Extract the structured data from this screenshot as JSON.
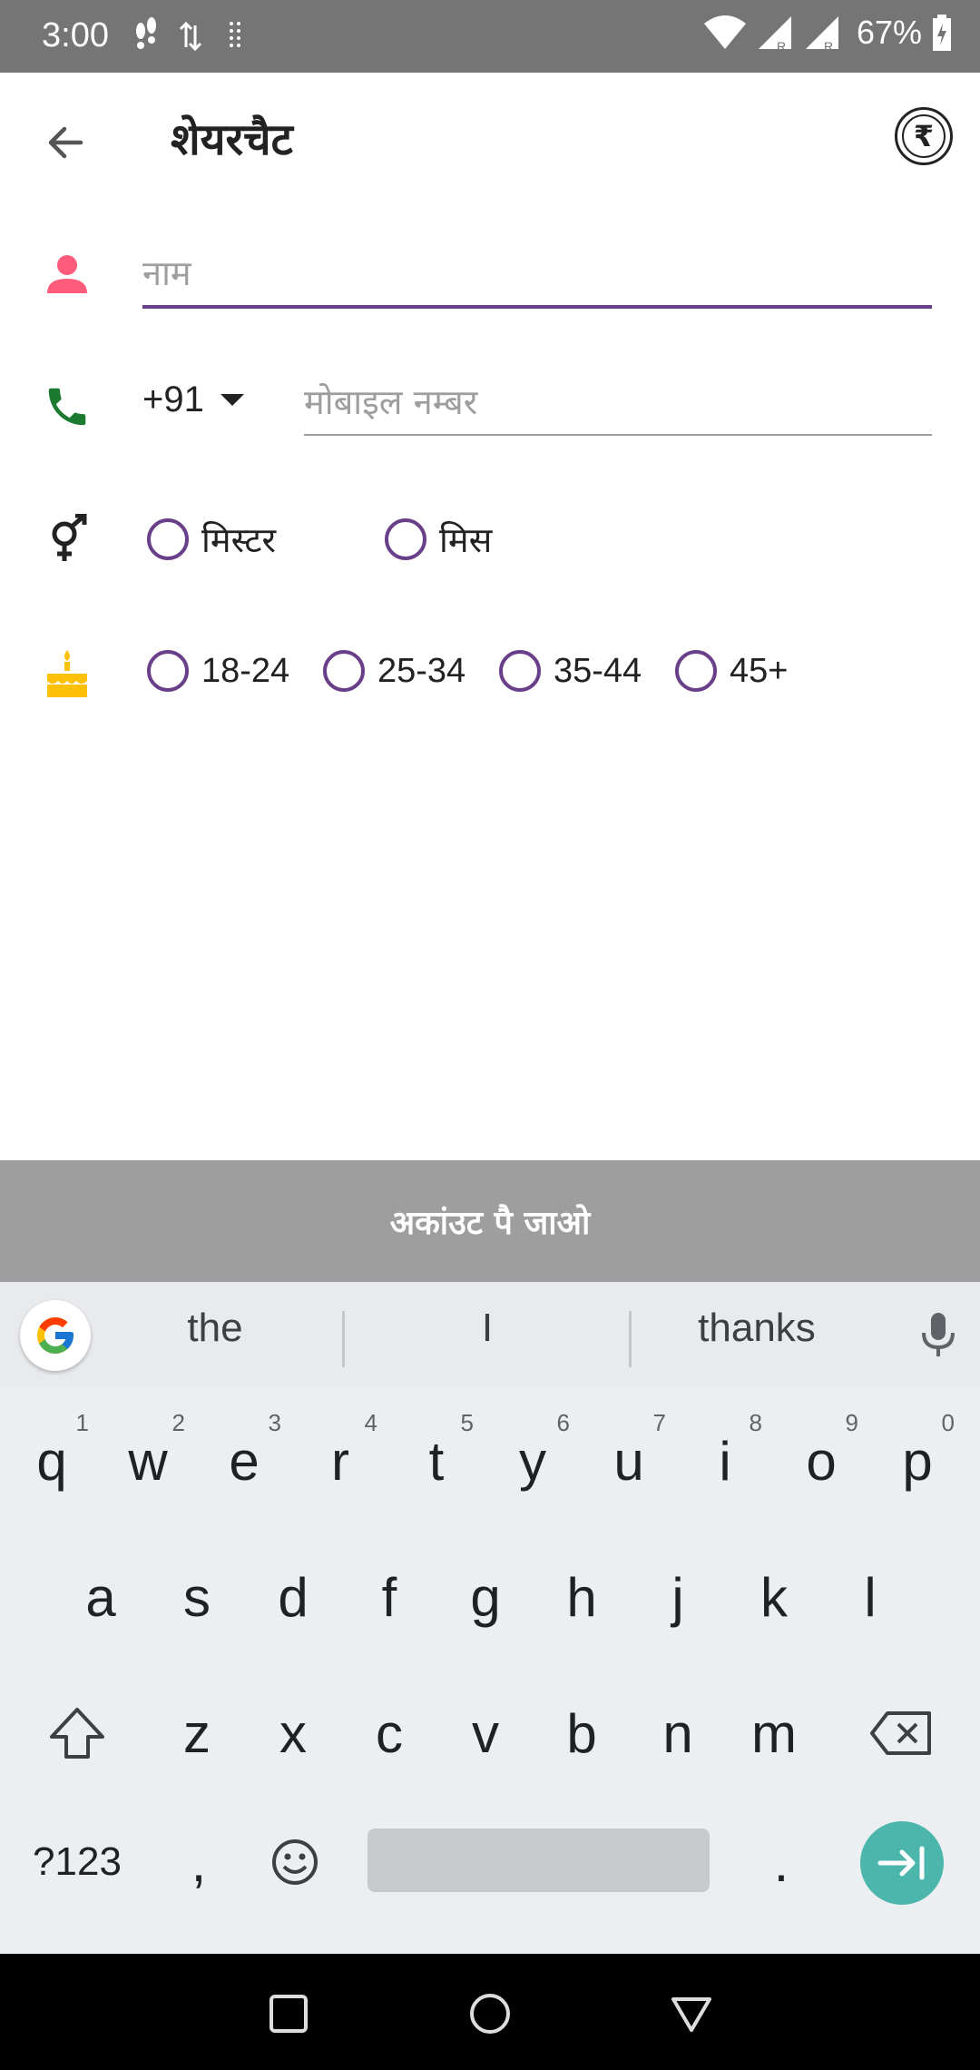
{
  "status_bar": {
    "time": "3:00",
    "battery": "67%"
  },
  "app_bar": {
    "title": "शेयरचैट",
    "rupee_symbol": "₹"
  },
  "form": {
    "name_placeholder": "नाम",
    "country_code": "+91",
    "phone_placeholder": "मोबाइल नम्बर",
    "gender_options": [
      "मिस्टर",
      "मिस"
    ],
    "age_options": [
      "18-24",
      "25-34",
      "35-44",
      "45+"
    ]
  },
  "submit": {
    "label": "अकांउट पै जाओ"
  },
  "keyboard": {
    "suggestions": [
      "the",
      "I",
      "thanks"
    ],
    "row1": [
      "q",
      "w",
      "e",
      "r",
      "t",
      "y",
      "u",
      "i",
      "o",
      "p"
    ],
    "row1_sup": [
      "1",
      "2",
      "3",
      "4",
      "5",
      "6",
      "7",
      "8",
      "9",
      "0"
    ],
    "row2": [
      "a",
      "s",
      "d",
      "f",
      "g",
      "h",
      "j",
      "k",
      "l"
    ],
    "row3": [
      "z",
      "x",
      "c",
      "v",
      "b",
      "n",
      "m"
    ],
    "symbols_label": "?123",
    "comma": ",",
    "period": "."
  },
  "colors": {
    "accent": "#6a3f8a",
    "status_bar": "#757575",
    "submit_bar": "#9e9e9e",
    "person_icon": "#ff5c7c",
    "phone_icon": "#1b7a2f",
    "cake_icon": "#ffc107",
    "enter_key": "#4db6ac"
  }
}
